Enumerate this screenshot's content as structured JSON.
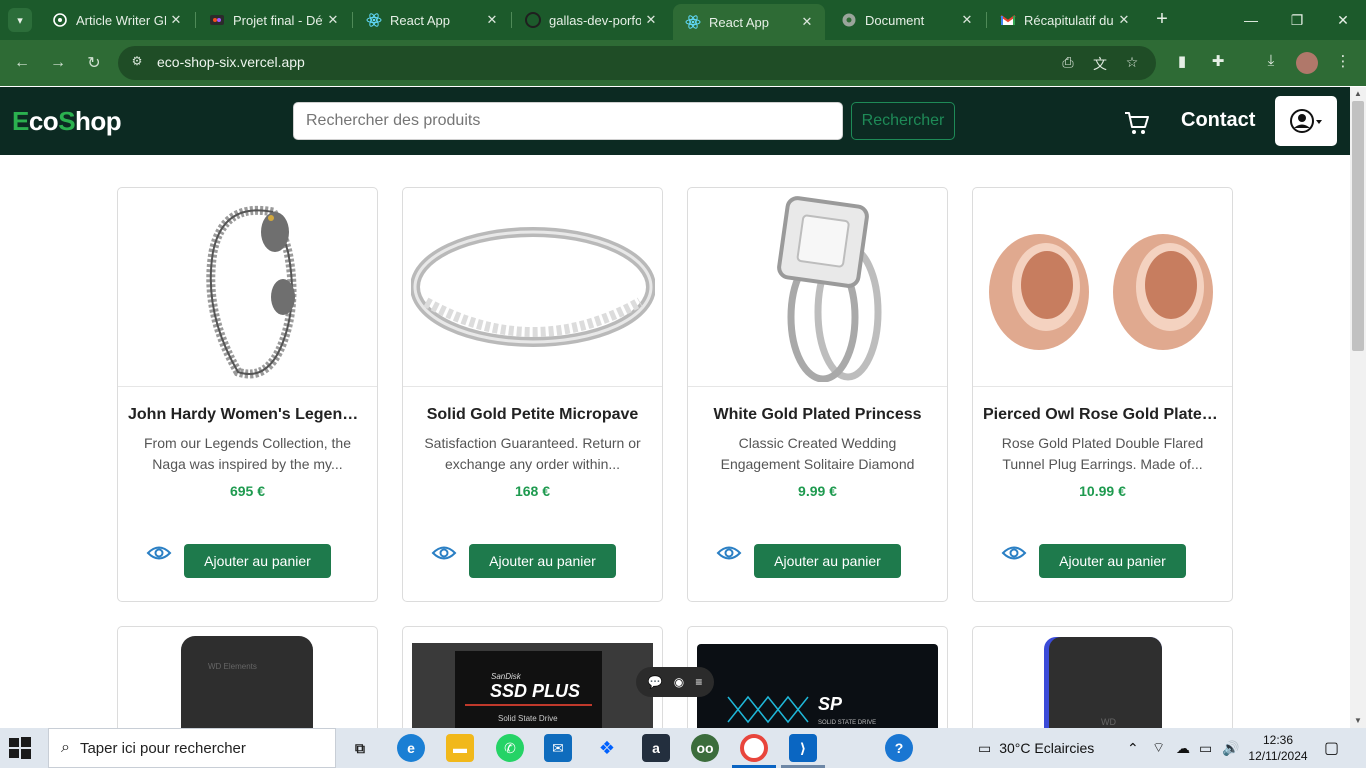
{
  "browser": {
    "tabs": [
      {
        "title": "Article Writer GPT",
        "favicon": "openai-icon",
        "active": false
      },
      {
        "title": "Projet final - Dév",
        "favicon": "figma-icon",
        "active": false
      },
      {
        "title": "React App",
        "favicon": "react-icon",
        "active": false
      },
      {
        "title": "gallas-dev-porfolio",
        "favicon": "github-icon",
        "active": false
      },
      {
        "title": "React App",
        "favicon": "react-icon",
        "active": true
      },
      {
        "title": "Document",
        "favicon": "globe-icon",
        "active": false
      },
      {
        "title": "Récapitulatif du",
        "favicon": "gmail-icon",
        "active": false
      }
    ],
    "url": "eco-shop-six.vercel.app",
    "theme_color": "#2e6b35"
  },
  "site": {
    "logo": {
      "first": "E",
      "part1": "co",
      "second": "S",
      "part2": "hop"
    },
    "search_placeholder": "Rechercher des produits",
    "search_button": "Rechercher",
    "contact_label": "Contact",
    "accent_color": "#1e7a4c"
  },
  "products": [
    {
      "name": "John Hardy Women's Legends Naga Gold & Silver Dragon Station Chain Bracelet",
      "description": "From our Legends Collection, the Naga was inspired by the my...",
      "price": "695 €",
      "add_label": "Ajouter au panier"
    },
    {
      "name": "Solid Gold Petite Micropave",
      "description": "Satisfaction Guaranteed. Return or exchange any order within...",
      "price": "168 €",
      "add_label": "Ajouter au panier"
    },
    {
      "name": "White Gold Plated Princess",
      "description": "Classic Created Wedding Engagement Solitaire Diamond",
      "price": "9.99 €",
      "add_label": "Ajouter au panier"
    },
    {
      "name": "Pierced Owl Rose Gold Plated Stainless Steel Double",
      "description": "Rose Gold Plated Double Flared Tunnel Plug Earrings. Made of...",
      "price": "10.99 €",
      "add_label": "Ajouter au panier"
    }
  ],
  "partial_products": [
    {
      "image_text_1": "WD Elements"
    },
    {
      "image_text_1": "SanDisk",
      "image_text_2": "SSD PLUS",
      "image_text_3": "Solid State Drive"
    },
    {
      "image_text_1": "SP",
      "image_text_2": "SOLID STATE DRIVE"
    },
    {
      "image_text_1": "WD"
    }
  ],
  "taskbar": {
    "search_placeholder": "Taper ici pour rechercher",
    "weather": "30°C  Eclaircies",
    "time": "12:36",
    "date": "12/11/2024"
  }
}
